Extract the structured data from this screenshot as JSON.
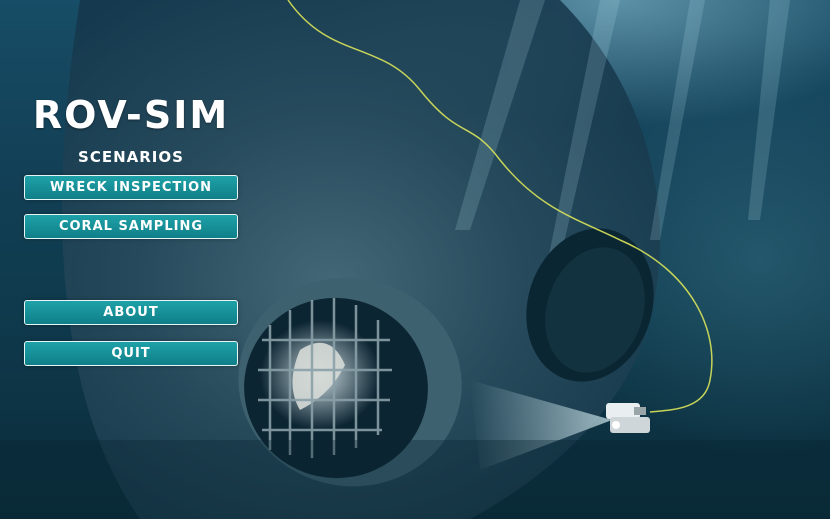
{
  "app": {
    "title": "ROV-SIM",
    "section_label": "SCENARIOS"
  },
  "menu": {
    "scenarios": [
      {
        "label": "WRECK INSPECTION"
      },
      {
        "label": "CORAL SAMPLING"
      }
    ],
    "about_label": "ABOUT",
    "quit_label": "QUIT"
  },
  "colors": {
    "button_fill": "#138a92",
    "button_border": "#e6f6f6",
    "text": "#ffffff",
    "water": "#0f3a4d"
  }
}
